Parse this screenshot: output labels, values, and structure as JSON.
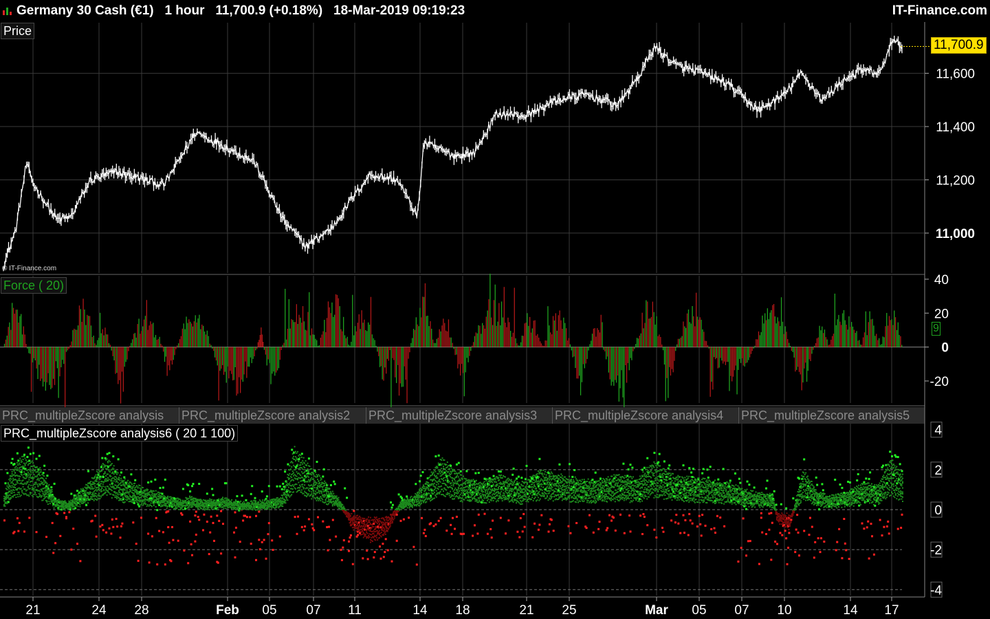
{
  "header": {
    "instrument": "Germany 30 Cash (€1)",
    "timeframe": "1 hour",
    "last_price": "11,700.9 (+0.18%)",
    "datetime": "18-Mar-2019 09:19:23",
    "site": "IT-Finance.com"
  },
  "watermark": "© IT-Finance.com",
  "panels": {
    "price_label": "Price",
    "force_label": "Force ( 20)",
    "zscore_label": "PRC_multipleZscore analysis6 ( 20 1 100)",
    "zscore_tabs": [
      "PRC_multipleZscore analysis",
      "PRC_multipleZscore analysis2",
      "PRC_multipleZscore analysis3",
      "PRC_multipleZscore analysis4",
      "PRC_multipleZscore analysis5"
    ]
  },
  "badges": {
    "price_value": "11,700.9",
    "force_value": "9"
  },
  "colors": {
    "price_line": "#ffffff",
    "positive": "#1fa21f",
    "negative": "#b01818",
    "bright_green": "#22ee22",
    "bright_red": "#ff2020",
    "dark_green": "#1d8a1d",
    "dark_red": "#7a0a0a",
    "grid": "#3a3a3a",
    "badge_bg": "#ffe000"
  },
  "chart_data": [
    {
      "type": "line",
      "name": "price",
      "x": [
        "2019-01-18",
        "2019-01-21",
        "2019-01-24",
        "2019-01-28",
        "2019-02-01",
        "2019-02-05",
        "2019-02-07",
        "2019-02-11",
        "2019-02-14",
        "2019-02-18",
        "2019-02-21",
        "2019-02-25",
        "2019-03-01",
        "2019-03-05",
        "2019-03-07",
        "2019-03-11",
        "2019-03-14",
        "2019-03-18"
      ],
      "x_tick_labels": [
        "21",
        "24",
        "28",
        "Feb",
        "05",
        "07",
        "11",
        "14",
        "18",
        "21",
        "25",
        "Mar",
        "05",
        "07",
        "10",
        "14",
        "17"
      ],
      "keypoints": [
        [
          0,
          10880
        ],
        [
          0.8,
          11010
        ],
        [
          1.5,
          11260
        ],
        [
          2.0,
          11180
        ],
        [
          3.5,
          11050
        ],
        [
          4.4,
          11060
        ],
        [
          5.7,
          11200
        ],
        [
          7.4,
          11230
        ],
        [
          10.5,
          11180
        ],
        [
          12.6,
          11380
        ],
        [
          16.4,
          11270
        ],
        [
          18.3,
          11050
        ],
        [
          19.8,
          10950
        ],
        [
          21.5,
          11020
        ],
        [
          22.8,
          11130
        ],
        [
          24.0,
          11220
        ],
        [
          25.8,
          11200
        ],
        [
          27.1,
          11060
        ],
        [
          27.5,
          11340
        ],
        [
          29.5,
          11290
        ],
        [
          30.8,
          11300
        ],
        [
          32.3,
          11450
        ],
        [
          34.2,
          11440
        ],
        [
          36.2,
          11500
        ],
        [
          38.2,
          11520
        ],
        [
          40.2,
          11480
        ],
        [
          41.7,
          11600
        ],
        [
          42.6,
          11700
        ],
        [
          44.0,
          11630
        ],
        [
          45.8,
          11600
        ],
        [
          47.4,
          11560
        ],
        [
          49.4,
          11460
        ],
        [
          51.1,
          11520
        ],
        [
          52.2,
          11600
        ],
        [
          53.6,
          11500
        ],
        [
          55.1,
          11580
        ],
        [
          56.1,
          11610
        ],
        [
          57.4,
          11600
        ],
        [
          58.1,
          11720
        ],
        [
          58.8,
          11705
        ]
      ],
      "y_ticks": [
        11000,
        11200,
        11400,
        11600
      ],
      "ylim": [
        10850,
        11790
      ],
      "last_value": 11700.9
    },
    {
      "type": "bar",
      "name": "Force ( 20)",
      "y_ticks": [
        -20,
        0,
        20,
        40
      ],
      "ylim": [
        -33,
        42
      ],
      "last_value": 9,
      "cycles": [
        [
          0,
          1.5,
          25
        ],
        [
          1.5,
          4.3,
          -22
        ],
        [
          4.3,
          6.0,
          24
        ],
        [
          6.0,
          7.0,
          12
        ],
        [
          7.0,
          8.2,
          -20
        ],
        [
          8.2,
          10.4,
          18
        ],
        [
          10.4,
          11.3,
          -18
        ],
        [
          11.3,
          13.6,
          22
        ],
        [
          13.6,
          16.6,
          -25
        ],
        [
          16.6,
          17.0,
          10
        ],
        [
          17.0,
          18.2,
          -22
        ],
        [
          18.2,
          20.6,
          22
        ],
        [
          20.6,
          22.6,
          28
        ],
        [
          22.6,
          24.4,
          20
        ],
        [
          24.4,
          25.3,
          -18
        ],
        [
          25.3,
          26.6,
          -25
        ],
        [
          26.6,
          28.2,
          26
        ],
        [
          28.2,
          29.4,
          20
        ],
        [
          29.4,
          30.6,
          -18
        ],
        [
          30.6,
          33.7,
          26
        ],
        [
          33.7,
          35.3,
          18
        ],
        [
          35.3,
          37.1,
          20
        ],
        [
          37.1,
          38.3,
          -20
        ],
        [
          38.3,
          39.2,
          12
        ],
        [
          39.2,
          41.3,
          -28
        ],
        [
          41.3,
          43.1,
          26
        ],
        [
          43.1,
          44.0,
          -22
        ],
        [
          44.0,
          46.1,
          22
        ],
        [
          46.1,
          49.1,
          -18
        ],
        [
          49.1,
          51.5,
          24
        ],
        [
          51.5,
          53.0,
          -22
        ],
        [
          53.0,
          54.0,
          12
        ],
        [
          54.0,
          56.1,
          22
        ],
        [
          56.1,
          57.4,
          16
        ],
        [
          57.4,
          58.8,
          24
        ]
      ]
    },
    {
      "type": "scatter",
      "name": "PRC_multipleZscore analysis6 ( 20 1 100)",
      "y_ticks": [
        -4,
        -2,
        0,
        2,
        4
      ],
      "ylim": [
        -4.3,
        4.3
      ],
      "dashed_levels": [
        -4,
        -2,
        2
      ],
      "keypoints": [
        [
          0,
          0.6
        ],
        [
          0.5,
          1.8
        ],
        [
          1.2,
          2.5
        ],
        [
          2.3,
          2.0
        ],
        [
          3.4,
          0.5
        ],
        [
          4.2,
          0.3
        ],
        [
          5.2,
          1.0
        ],
        [
          6.3,
          1.9
        ],
        [
          6.8,
          2.4
        ],
        [
          7.6,
          1.5
        ],
        [
          9.0,
          1.0
        ],
        [
          10.4,
          0.7
        ],
        [
          11.6,
          0.4
        ],
        [
          12.3,
          0.6
        ],
        [
          13.1,
          0.4
        ],
        [
          14.4,
          0.5
        ],
        [
          15.6,
          0.3
        ],
        [
          17.1,
          0.4
        ],
        [
          18.2,
          0.6
        ],
        [
          19.0,
          2.9
        ],
        [
          20.0,
          2.0
        ],
        [
          21.3,
          1.0
        ],
        [
          22.0,
          0.4
        ],
        [
          22.8,
          -0.8
        ],
        [
          24.0,
          -1.4
        ],
        [
          25.0,
          -1.1
        ],
        [
          26.0,
          0.4
        ],
        [
          26.8,
          0.6
        ],
        [
          27.5,
          1.2
        ],
        [
          28.6,
          2.4
        ],
        [
          30.0,
          1.5
        ],
        [
          31.2,
          1.3
        ],
        [
          32.5,
          1.6
        ],
        [
          33.8,
          1.2
        ],
        [
          35.1,
          1.8
        ],
        [
          36.4,
          1.6
        ],
        [
          37.6,
          1.4
        ],
        [
          38.8,
          1.3
        ],
        [
          40.1,
          1.6
        ],
        [
          41.5,
          1.4
        ],
        [
          42.4,
          2.2
        ],
        [
          43.8,
          1.6
        ],
        [
          45.6,
          1.4
        ],
        [
          47.4,
          1.2
        ],
        [
          49.0,
          0.8
        ],
        [
          50.3,
          0.7
        ],
        [
          50.6,
          -0.5
        ],
        [
          51.4,
          -0.8
        ],
        [
          52.3,
          1.8
        ],
        [
          53.2,
          0.9
        ],
        [
          54.0,
          0.6
        ],
        [
          55.2,
          0.8
        ],
        [
          56.2,
          1.2
        ],
        [
          57.2,
          1.1
        ],
        [
          58.0,
          2.4
        ],
        [
          58.8,
          1.6
        ]
      ]
    }
  ]
}
